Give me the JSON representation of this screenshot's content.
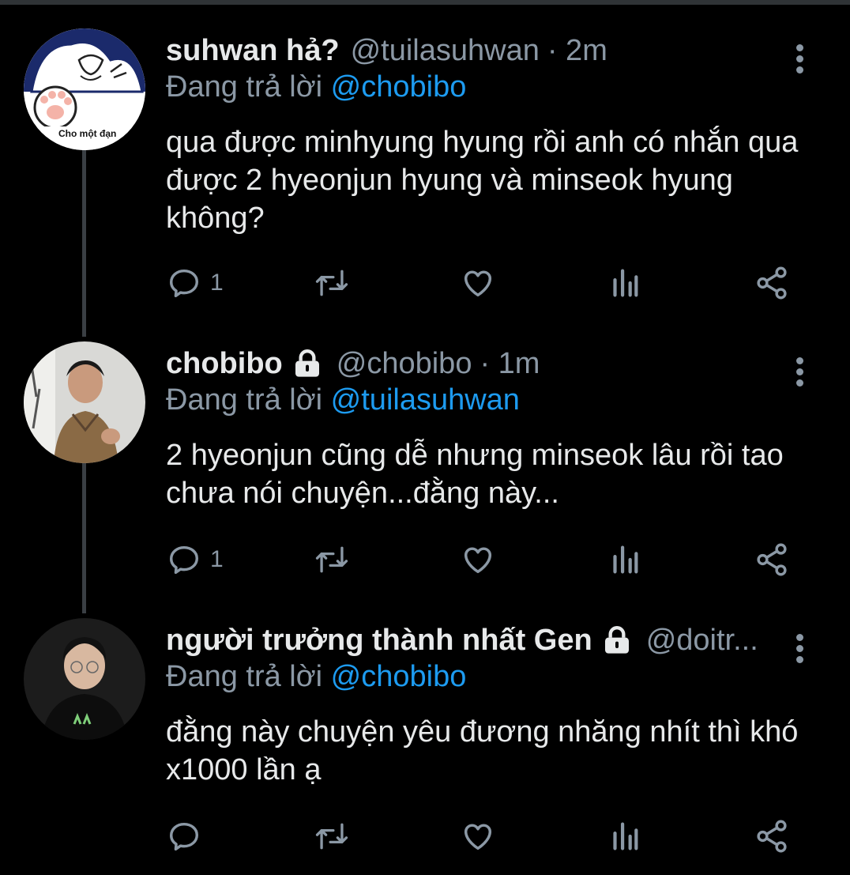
{
  "tweets": [
    {
      "name": "suhwan hả?",
      "handle": "@tuilasuhwan",
      "time": "· 2m",
      "reply_prefix": "Đang trả lời ",
      "reply_to": "@chobibo",
      "text": "qua được minhyung hyung rồi anh có nhắn qua được 2 hyeonjun hyung và minseok hyung không?",
      "reply_count": "1",
      "avatar_caption": "Cho một đạn"
    },
    {
      "name": "chobibo",
      "handle": "@chobibo",
      "time": "· 1m",
      "reply_prefix": "Đang trả lời ",
      "reply_to": "@tuilasuhwan",
      "text": "2 hyeonjun cũng dễ nhưng minseok lâu rồi tao chưa nói chuyện...đằng này...",
      "reply_count": "1"
    },
    {
      "name": "người trưởng thành nhất Gen",
      "handle": "@doitr...",
      "time": "",
      "reply_prefix": "Đang trả lời ",
      "reply_to": "@chobibo",
      "text": "đằng này chuyện yêu đương nhăng nhít thì khó x1000 lần ạ",
      "reply_count": ""
    }
  ],
  "icons": [
    "reply-icon",
    "retweet-icon",
    "like-icon",
    "analytics-icon",
    "share-icon",
    "more-icon",
    "lock-icon"
  ],
  "colors": {
    "background": "#000000",
    "text": "#e7e9ea",
    "muted": "#8b98a5",
    "accent": "#1d9bf0"
  }
}
